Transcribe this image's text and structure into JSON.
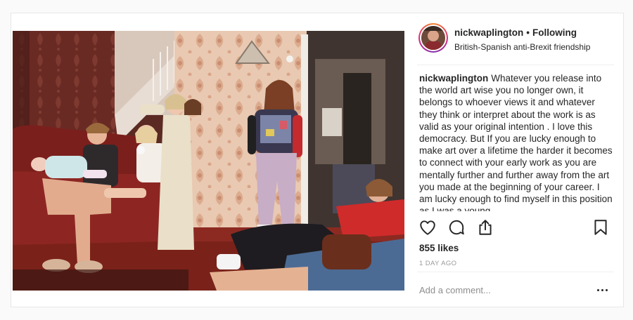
{
  "post": {
    "username": "nickwaplington",
    "separator": "•",
    "follow_status": "Following",
    "location": "British-Spanish anti-Brexit friendship",
    "caption_user": "nickwaplington",
    "caption_text": "Whatever you release into the world art wise you no longer own, it belongs to whoever views it and whatever they think or interpret about the work is as valid as your original intention . I love this democracy. But If you are lucky enough to make art over a lifetime the harder it becomes to connect with your early work as you are mentally further and further away from the art you made at the beginning of your career. I am lucky enough to find myself in this position as I was a young",
    "likes": "855 likes",
    "timestamp": "1 DAY AGO",
    "comment_placeholder": "Add a comment..."
  },
  "icons": {
    "like": "heart-icon",
    "comment": "comment-icon",
    "share": "share-icon",
    "save": "bookmark-icon",
    "more": "more-options-icon"
  },
  "colors": {
    "text": "#262626",
    "muted": "#999999",
    "border": "#efefef",
    "story_ring": "#dd2a7b"
  }
}
